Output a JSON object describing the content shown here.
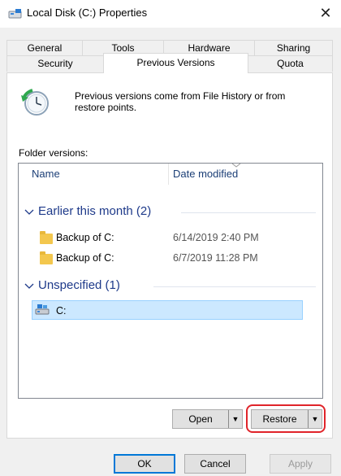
{
  "window": {
    "title": "Local Disk (C:) Properties",
    "close_symbol": "✕"
  },
  "tabs": {
    "row1": [
      "General",
      "Tools",
      "Hardware",
      "Sharing"
    ],
    "row2": [
      "Security",
      "Previous Versions",
      "Quota"
    ],
    "active": "Previous Versions"
  },
  "page": {
    "info_text": "Previous versions come from File History or from restore points.",
    "folder_versions_label": "Folder versions:"
  },
  "list": {
    "columns": [
      "Name",
      "Date modified"
    ],
    "groups": [
      {
        "title": "Earlier this month (2)",
        "items": [
          {
            "name": "Backup of C:",
            "date": "6/14/2019 2:40 PM",
            "icon": "folder-icon"
          },
          {
            "name": "Backup of C:",
            "date": "6/7/2019 11:28 PM",
            "icon": "folder-icon"
          }
        ]
      },
      {
        "title": "Unspecified (1)",
        "items": [
          {
            "name": "C:",
            "date": "",
            "icon": "drive-icon",
            "selected": true
          }
        ]
      }
    ]
  },
  "buttons": {
    "open": "Open",
    "restore": "Restore",
    "ok": "OK",
    "cancel": "Cancel",
    "apply": "Apply"
  },
  "colors": {
    "group_header": "#1e3a8a",
    "selection": "#cce8ff",
    "highlight_ring": "#e0242a",
    "folder": "#f3c74e"
  }
}
